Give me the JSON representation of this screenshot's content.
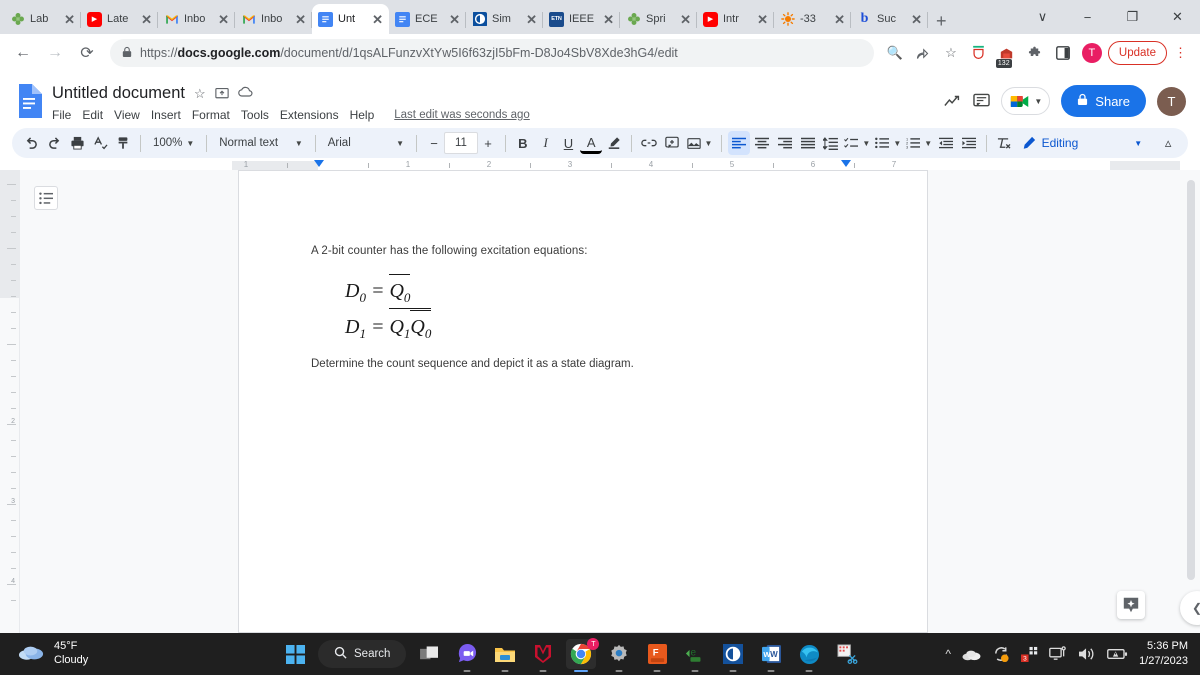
{
  "browser": {
    "tabs": [
      {
        "title": "Lab",
        "icon": "clover-icon",
        "active": false
      },
      {
        "title": "Late",
        "icon": "youtube-icon",
        "active": false
      },
      {
        "title": "Inbo",
        "icon": "gmail-icon",
        "active": false
      },
      {
        "title": "Inbo",
        "icon": "gmail-icon",
        "active": false
      },
      {
        "title": "Unt",
        "icon": "google-docs-icon",
        "active": true
      },
      {
        "title": "ECE",
        "icon": "google-docs-icon",
        "active": false
      },
      {
        "title": "Sim",
        "icon": "simulator-icon",
        "active": false
      },
      {
        "title": "IEEE",
        "icon": "etn-icon",
        "active": false
      },
      {
        "title": "Spri",
        "icon": "clover-icon",
        "active": false
      },
      {
        "title": "Intr",
        "icon": "youtube-icon",
        "active": false
      },
      {
        "title": "-33",
        "icon": "sun-icon",
        "active": false
      },
      {
        "title": "Suc",
        "icon": "brainly-b-icon",
        "active": false
      }
    ],
    "new_tab_label": "+",
    "window_controls": [
      "∨",
      "−",
      "❐",
      "✕"
    ],
    "url_prefix": "https://",
    "url_domain": "docs.google.com",
    "url_path": "/document/d/1qsALFunzvXtYw5I6f63zjI5bFm-D8Jo4SbV8Xde3hG4/edit",
    "extension_badge_count": "132",
    "profile_initial": "T",
    "update_label": "Update",
    "accent_update": "#d93025"
  },
  "docs": {
    "title": "Untitled document",
    "menus": [
      "File",
      "Edit",
      "View",
      "Insert",
      "Format",
      "Tools",
      "Extensions",
      "Help"
    ],
    "last_edit": "Last edit was seconds ago",
    "share_label": "Share",
    "account_initial": "T",
    "share_color": "#1a73e8"
  },
  "toolbar": {
    "zoom": "100%",
    "style": "Normal text",
    "font": "Arial",
    "font_size": "11",
    "decrease_label": "−",
    "increase_label": "+",
    "bold": "B",
    "italic": "I",
    "underline": "U",
    "text_color": "A",
    "mode": "Editing"
  },
  "ruler": {
    "numbers": [
      "1",
      "1",
      "2",
      "3",
      "4",
      "5",
      "6",
      "7"
    ]
  },
  "document": {
    "paragraph_1": "A 2-bit counter has the following excitation equations:",
    "equation_1": {
      "lhs": "D",
      "lhs_sub": "0",
      "rhs_var": "Q",
      "rhs_sub": "0"
    },
    "equation_2": {
      "lhs": "D",
      "lhs_sub": "1",
      "rhs_var1": "Q",
      "rhs_sub1": "1",
      "rhs_var2": "Q",
      "rhs_sub2": "0"
    },
    "paragraph_2": "Determine the count sequence and depict it as a state diagram."
  },
  "taskbar": {
    "weather_temp": "45°F",
    "weather_desc": "Cloudy",
    "search_label": "Search",
    "apps": [
      {
        "name": "start-button"
      },
      {
        "name": "task-view"
      },
      {
        "name": "teams-icon"
      },
      {
        "name": "file-explorer-icon"
      },
      {
        "name": "mcafee-icon"
      },
      {
        "name": "chrome-icon"
      },
      {
        "name": "settings-gear-icon"
      },
      {
        "name": "fusion-icon",
        "label": "F"
      },
      {
        "name": "e2020-icon",
        "label": "e"
      },
      {
        "name": "multisim-icon"
      },
      {
        "name": "word-icon",
        "label": "W"
      },
      {
        "name": "edge-icon"
      },
      {
        "name": "snip-tool-icon"
      }
    ],
    "tray_badge": "3",
    "time": "5:36 PM",
    "date": "1/27/2023"
  }
}
